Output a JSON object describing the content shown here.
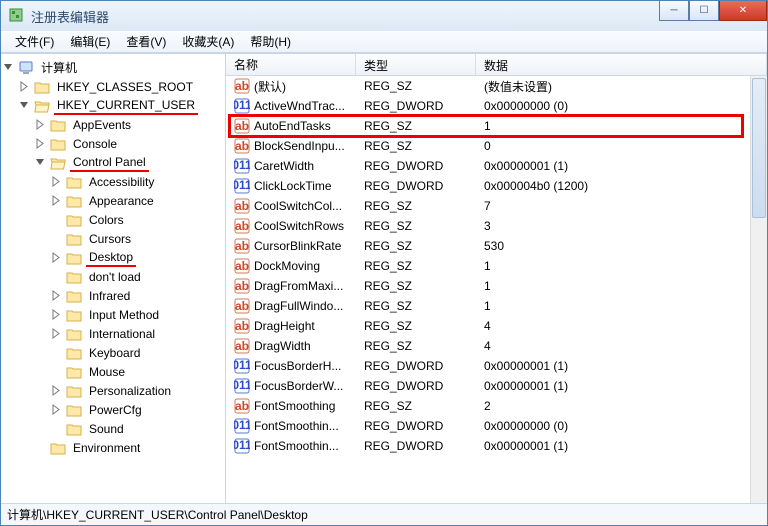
{
  "window": {
    "title": "注册表编辑器"
  },
  "menu": {
    "file": "文件(F)",
    "edit": "编辑(E)",
    "view": "查看(V)",
    "fav": "收藏夹(A)",
    "help": "帮助(H)"
  },
  "tree": {
    "root": "计算机",
    "hkcr": "HKEY_CLASSES_ROOT",
    "hkcu": "HKEY_CURRENT_USER",
    "appevents": "AppEvents",
    "console": "Console",
    "cpl": "Control Panel",
    "accessibility": "Accessibility",
    "appearance": "Appearance",
    "colors": "Colors",
    "cursors": "Cursors",
    "desktop": "Desktop",
    "dontload": "don't load",
    "infrared": "Infrared",
    "inputmethod": "Input Method",
    "international": "International",
    "keyboard": "Keyboard",
    "mouse": "Mouse",
    "personalization": "Personalization",
    "powercfg": "PowerCfg",
    "sound": "Sound",
    "environment": "Environment"
  },
  "columns": {
    "name": "名称",
    "type": "类型",
    "data": "数据"
  },
  "reg_sz": "REG_SZ",
  "reg_dword": "REG_DWORD",
  "rows": {
    "r0": {
      "name": "(默认)",
      "data": "(数值未设置)"
    },
    "r1": {
      "name": "ActiveWndTrac...",
      "data": "0x00000000 (0)"
    },
    "r2": {
      "name": "AutoEndTasks",
      "data": "1"
    },
    "r3": {
      "name": "BlockSendInpu...",
      "data": "0"
    },
    "r4": {
      "name": "CaretWidth",
      "data": "0x00000001 (1)"
    },
    "r5": {
      "name": "ClickLockTime",
      "data": "0x000004b0 (1200)"
    },
    "r6": {
      "name": "CoolSwitchCol...",
      "data": "7"
    },
    "r7": {
      "name": "CoolSwitchRows",
      "data": "3"
    },
    "r8": {
      "name": "CursorBlinkRate",
      "data": "530"
    },
    "r9": {
      "name": "DockMoving",
      "data": "1"
    },
    "r10": {
      "name": "DragFromMaxi...",
      "data": "1"
    },
    "r11": {
      "name": "DragFullWindo...",
      "data": "1"
    },
    "r12": {
      "name": "DragHeight",
      "data": "4"
    },
    "r13": {
      "name": "DragWidth",
      "data": "4"
    },
    "r14": {
      "name": "FocusBorderH...",
      "data": "0x00000001 (1)"
    },
    "r15": {
      "name": "FocusBorderW...",
      "data": "0x00000001 (1)"
    },
    "r16": {
      "name": "FontSmoothing",
      "data": "2"
    },
    "r17": {
      "name": "FontSmoothin...",
      "data": "0x00000000 (0)"
    },
    "r18": {
      "name": "FontSmoothin...",
      "data": "0x00000001 (1)"
    }
  },
  "status": "计算机\\HKEY_CURRENT_USER\\Control Panel\\Desktop"
}
